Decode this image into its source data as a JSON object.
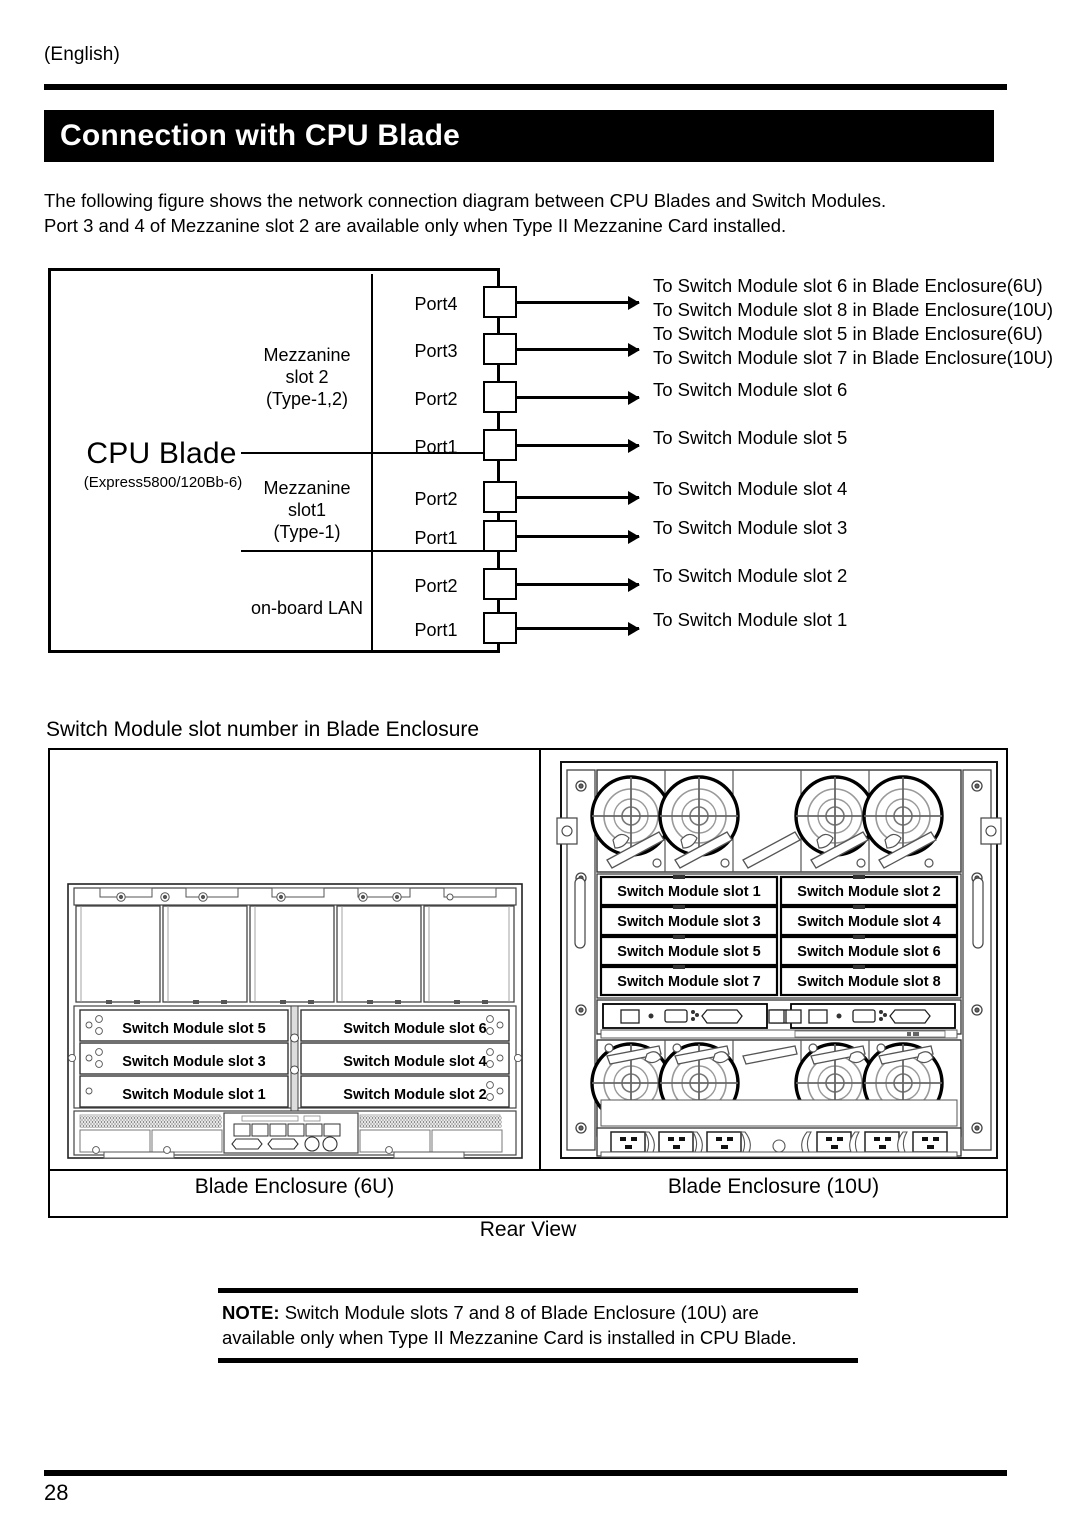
{
  "page": {
    "language_tag": "(English)",
    "title": "Connection with CPU Blade",
    "page_number": "28"
  },
  "intro": {
    "line1": "The following figure shows the network connection diagram between CPU Blades and Switch Modules.",
    "line2": "Port 3 and 4 of Mezzanine slot 2 are available only when Type II Mezzanine Card installed."
  },
  "diagram": {
    "blade_name": "CPU Blade",
    "blade_model": "(Express5800/120Bb-6)",
    "groups": [
      {
        "id": "mezz2",
        "label_line1": "Mezzanine",
        "label_line2": "slot 2",
        "label_line3": "(Type-1,2)"
      },
      {
        "id": "mezz1",
        "label_line1": "Mezzanine",
        "label_line2": "slot1",
        "label_line3": "(Type-1)"
      },
      {
        "id": "onboard",
        "label_line1": "on-board LAN",
        "label_line2": "",
        "label_line3": ""
      }
    ],
    "ports": [
      {
        "label": "Port4",
        "dest_line1": "To Switch Module slot 6 in Blade Enclosure(6U)",
        "dest_line2": "To Switch Module slot 8 in Blade Enclosure(10U)"
      },
      {
        "label": "Port3",
        "dest_line1": "To Switch Module slot 5 in Blade Enclosure(6U)",
        "dest_line2": "To Switch Module slot 7 in Blade Enclosure(10U)"
      },
      {
        "label": "Port2",
        "dest_line1": "To Switch Module slot 6",
        "dest_line2": ""
      },
      {
        "label": "Port1",
        "dest_line1": "To Switch Module slot 5",
        "dest_line2": ""
      },
      {
        "label": "Port2",
        "dest_line1": "To Switch Module slot 4",
        "dest_line2": ""
      },
      {
        "label": "Port1",
        "dest_line1": "To Switch Module slot 3",
        "dest_line2": ""
      },
      {
        "label": "Port2",
        "dest_line1": "To Switch Module slot 2",
        "dest_line2": ""
      },
      {
        "label": "Port1",
        "dest_line1": "To Switch Module slot 1",
        "dest_line2": ""
      }
    ]
  },
  "enclosure_section": {
    "caption": "Switch Module slot number in Blade Enclosure",
    "rear_view_label": "Rear View",
    "enclosure_6u": {
      "footer_label": "Blade Enclosure (6U)",
      "switch_slots": [
        "Switch Module slot 5",
        "Switch Module slot 6",
        "Switch Module slot 3",
        "Switch Module slot 4",
        "Switch Module slot 1",
        "Switch Module slot 2"
      ]
    },
    "enclosure_10u": {
      "footer_label": "Blade Enclosure (10U)",
      "switch_slots": [
        "Switch Module slot 1",
        "Switch Module slot 2",
        "Switch Module slot 3",
        "Switch Module slot 4",
        "Switch Module slot 5",
        "Switch Module slot 6",
        "Switch Module slot 7",
        "Switch Module slot 8"
      ]
    }
  },
  "note": {
    "prefix": "NOTE:",
    "line1": " Switch Module slots 7 and 8 of Blade Enclosure (10U) are",
    "line2": "available only when Type II Mezzanine Card is installed in CPU Blade."
  }
}
